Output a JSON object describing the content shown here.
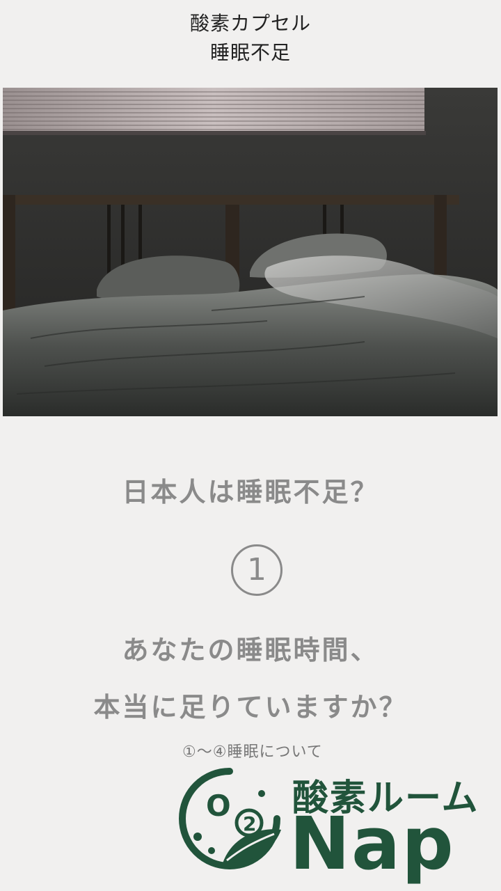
{
  "header": {
    "line1": "酸素カプセル",
    "line2": "睡眠不足"
  },
  "content": {
    "question_title": "日本人は睡眠不足？",
    "number": "1",
    "body_line1": "あなたの睡眠時間、",
    "body_line2": "本当に足りていますか？",
    "caption": "①〜④睡眠について"
  },
  "logo": {
    "mark_text": "O",
    "mark_sub": "2",
    "name": "酸素ルーム",
    "nap": "Nap"
  },
  "colors": {
    "background": "#f1f0ef",
    "text_gray": "#8a8a8a",
    "brand_green": "#21543b"
  }
}
